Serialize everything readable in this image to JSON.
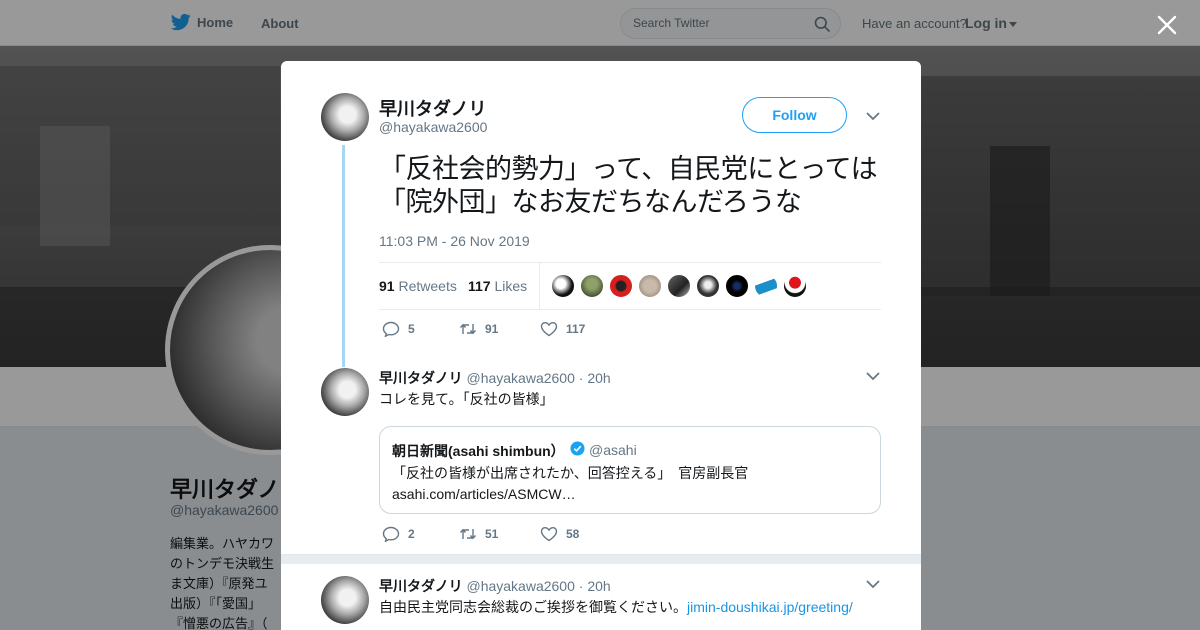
{
  "topnav": {
    "home_label": "Home",
    "about_label": "About",
    "search_placeholder": "Search Twitter",
    "have_account": "Have an account?",
    "login_label": "Log in"
  },
  "profile_bg": {
    "name": "早川タダノ",
    "handle": "@hayakawa2600",
    "bio": "編集業。ハヤカワ\nのトンデモ決戦生\nま文庫）『原発ユ\n出版）『「愛国」\n『憎悪の広告』（"
  },
  "tweet": {
    "author_name": "早川タダノリ",
    "author_handle": "@hayakawa2600",
    "follow_label": "Follow",
    "text": "「反社会的勢力」って、自民党にとっては「院外団」なお友だちなんだろうな",
    "timestamp": "11:03 PM - 26 Nov 2019",
    "retweets_count": "91",
    "retweets_label": "Retweets",
    "likes_count": "117",
    "likes_label": "Likes",
    "actions": {
      "replies": "5",
      "retweets": "91",
      "likes": "117"
    }
  },
  "replies": [
    {
      "name": "早川タダノリ",
      "handle": "@hayakawa2600",
      "time": "· 20h",
      "text": "コレを見て。「反社の皆様」",
      "quote": {
        "name": "朝日新聞(asahi shimbun）",
        "handle": "@asahi",
        "text": "「反社の皆様が出席されたか、回答控える」　官房副長官",
        "link": "asahi.com/articles/ASMCW…"
      },
      "actions": {
        "replies": "2",
        "retweets": "51",
        "likes": "58"
      }
    },
    {
      "name": "早川タダノリ",
      "handle": "@hayakawa2600",
      "time": "· 20h",
      "text": "自由民主党同志会総裁のご挨拶を御覧ください。",
      "link": "jimin-doushikai.jp/greeting/"
    }
  ],
  "colors": {
    "brand": "#1da1f2",
    "link": "#1b95e0",
    "thread_line": "#a6d6f3",
    "muted": "#657786"
  },
  "icons": [
    "twitter-bird-icon",
    "search-icon",
    "close-icon",
    "chevron-down-icon",
    "reply-icon",
    "retweet-icon",
    "heart-icon",
    "verified-icon"
  ]
}
